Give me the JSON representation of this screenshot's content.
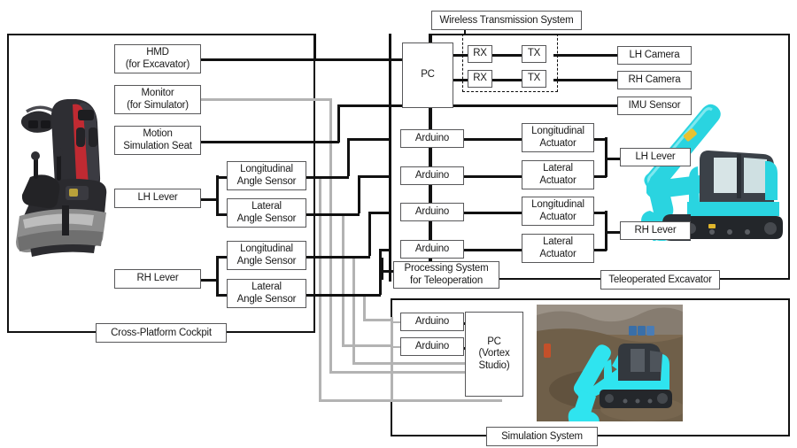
{
  "diagram": {
    "title": "Teleoperation system block diagram",
    "colors": {
      "wire_primary": "#111111",
      "wire_secondary": "#b3b3b3",
      "box_border": "#58585a",
      "group_border": "#111111",
      "excavator_cyan": "#2ad4e0"
    }
  },
  "groups": {
    "cockpit": {
      "label": "Cross-Platform Cockpit"
    },
    "wireless": {
      "label": "Wireless Transmission System"
    },
    "teleop": {
      "label": "Teleoperated Excavator"
    },
    "simulation": {
      "label": "Simulation System"
    },
    "processing": {
      "label_line1": "Processing System",
      "label_line2": "for Teleoperation"
    }
  },
  "cockpit": {
    "displays": [
      {
        "line1": "HMD",
        "line2": "(for Excavator)"
      },
      {
        "line1": "Monitor",
        "line2": "(for Simulator)"
      },
      {
        "line1": "Motion",
        "line2": "Simulation Seat"
      }
    ],
    "levers": [
      {
        "label": "LH Lever"
      },
      {
        "label": "RH Lever"
      }
    ],
    "sensors": [
      {
        "line1": "Longitudinal",
        "line2": "Angle Sensor"
      },
      {
        "line1": "Lateral",
        "line2": "Angle Sensor"
      },
      {
        "line1": "Longitudinal",
        "line2": "Angle Sensor"
      },
      {
        "line1": "Lateral",
        "line2": "Angle Sensor"
      }
    ],
    "photo_alt": "Cross-platform cockpit seat with levers and VR headset"
  },
  "processing": {
    "pc": {
      "label": "PC"
    },
    "rx": [
      {
        "label": "RX"
      },
      {
        "label": "RX"
      }
    ],
    "arduinos": [
      {
        "label": "Arduino"
      },
      {
        "label": "Arduino"
      },
      {
        "label": "Arduino"
      },
      {
        "label": "Arduino"
      }
    ]
  },
  "teleop": {
    "tx": [
      {
        "label": "TX"
      },
      {
        "label": "TX"
      }
    ],
    "sensors": [
      {
        "label": "LH Camera"
      },
      {
        "label": "RH Camera"
      },
      {
        "label": "IMU Sensor"
      }
    ],
    "actuators": [
      {
        "line1": "Longitudinal",
        "line2": "Actuator"
      },
      {
        "line1": "Lateral",
        "line2": "Actuator"
      },
      {
        "line1": "Longitudinal",
        "line2": "Actuator"
      },
      {
        "line1": "Lateral",
        "line2": "Actuator"
      }
    ],
    "levers": [
      {
        "label": "LH Lever"
      },
      {
        "label": "RH Lever"
      }
    ],
    "photo_alt": "Cyan hydraulic excavator machine"
  },
  "simulation": {
    "arduinos": [
      {
        "label": "Arduino"
      },
      {
        "label": "Arduino"
      }
    ],
    "pc": {
      "line1": "PC",
      "line2": "(Vortex",
      "line3": "Studio)"
    },
    "photo_alt": "Vortex Studio simulated cyan excavator on dirt terrain"
  }
}
